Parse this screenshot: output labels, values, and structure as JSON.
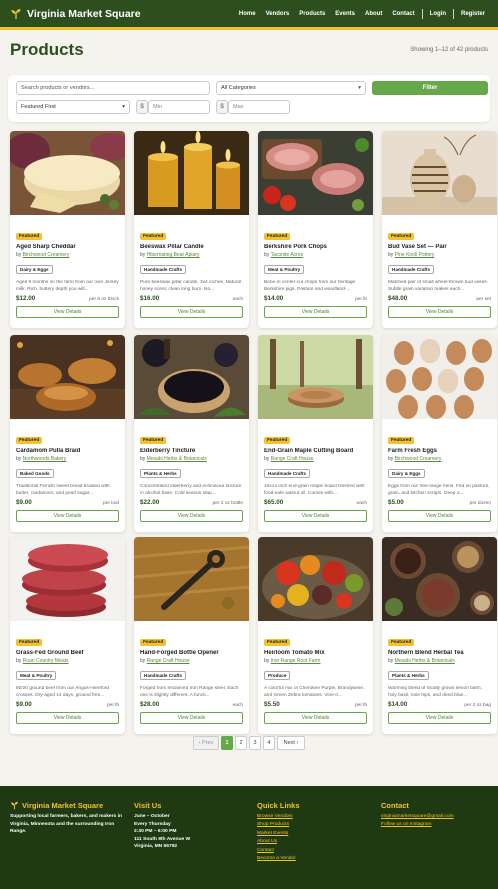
{
  "brand": "Virginia Market Square",
  "nav": {
    "links": [
      "Home",
      "Vendors",
      "Products",
      "Events",
      "About",
      "Contact"
    ],
    "account": [
      "Login",
      "Register"
    ]
  },
  "page": {
    "title": "Products",
    "showing": "Showing 1–12 of 42 products"
  },
  "filters": {
    "search_placeholder": "Search products or vendors...",
    "category_value": "All Categories",
    "sort_value": "Featured First",
    "currency_symbol": "$",
    "min_placeholder": "Min",
    "max_placeholder": "Max",
    "button_label": "Filter"
  },
  "products": [
    {
      "name": "Aged Sharp Cheddar",
      "featured": "Featured",
      "by": "by",
      "vendor": "Birchwood Creamery",
      "category": "Dairy & Eggs",
      "desc": "Aged 9 months on the farm from our own Jersey milk. Rich, buttery depth you will...",
      "price": "$12.00",
      "unit": "per 8 oz block",
      "button": "View Details",
      "image": "cheese"
    },
    {
      "name": "Beeswax Pillar Candle",
      "featured": "Featured",
      "by": "by",
      "vendor": "Hibernating Bear Apiary",
      "category": "Handmade Crafts",
      "desc": "Pure beeswax pillar candle, 3x4 inches. Natural honey scent, clean long burn. No...",
      "price": "$16.00",
      "unit": "each",
      "button": "View Details",
      "image": "candle"
    },
    {
      "name": "Berkshire Pork Chops",
      "featured": "Featured",
      "by": "by",
      "vendor": "Taconite Acres",
      "category": "Meat & Poultry",
      "desc": "Bone-in center-cut chops from our heritage Berkshire pigs. Pasture and woodland-...",
      "price": "$14.00",
      "unit": "per lb",
      "button": "View Details",
      "image": "pork"
    },
    {
      "name": "Bud Vase Set — Pair",
      "featured": "Featured",
      "by": "by",
      "vendor": "Pine Knoll Pottery",
      "category": "Handmade Crafts",
      "desc": "Matched pair of small wheel-thrown bud vases. Subtle grain variation makes each...",
      "price": "$48.00",
      "unit": "per set",
      "button": "View Details",
      "image": "vase"
    },
    {
      "name": "Cardamom Pulla Braid",
      "featured": "Featured",
      "by": "by",
      "vendor": "Northwoods Bakery",
      "category": "Baked Goods",
      "desc": "Traditional Finnish sweet bread braided with butter, cardamom, and pearl sugar...",
      "price": "$9.00",
      "unit": "per loaf",
      "button": "View Details",
      "image": "bread"
    },
    {
      "name": "Elderberry Tincture",
      "featured": "Featured",
      "by": "by",
      "vendor": "Mesabi Herbs & Botanicals",
      "category": "Plants & Herbs",
      "desc": "Concentrated elderberry and echinacea tincture in alcohol base. Cold season stap...",
      "price": "$22.00",
      "unit": "per 2 oz bottle",
      "button": "View Details",
      "image": "elderberry"
    },
    {
      "name": "End-Grain Maple Cutting Board",
      "featured": "Featured",
      "by": "by",
      "vendor": "Range Craft House",
      "category": "Handmade Crafts",
      "desc": "10x14 inch end-grain maple board finished with food-safe walnut oil. Comes with...",
      "price": "$65.00",
      "unit": "each",
      "button": "View Details",
      "image": "board"
    },
    {
      "name": "Farm Fresh Eggs",
      "featured": "Featured",
      "by": "by",
      "vendor": "Birchwood Creamery",
      "category": "Dairy & Eggs",
      "desc": "Eggs from our free-range hens. Fed on pasture, grain, and kitchen scraps. Deep o...",
      "price": "$5.00",
      "unit": "per dozen",
      "button": "View Details",
      "image": "eggs"
    },
    {
      "name": "Grass-Fed Ground Beef",
      "featured": "Featured",
      "by": "by",
      "vendor": "Roan Country Meats",
      "category": "Meat & Poultry",
      "desc": "80/20 ground beef from our Angus-Hereford crosses. Dry-aged 14 days, ground fres...",
      "price": "$9.00",
      "unit": "per lb",
      "button": "View Details",
      "image": "beef"
    },
    {
      "name": "Hand-Forged Bottle Opener",
      "featured": "Featured",
      "by": "by",
      "vendor": "Range Craft House",
      "category": "Handmade Crafts",
      "desc": "Forged from reclaimed Iron Range steel. Each one is slightly different. A functi...",
      "price": "$28.00",
      "unit": "each",
      "button": "View Details",
      "image": "opener"
    },
    {
      "name": "Heirloom Tomato Mix",
      "featured": "Featured",
      "by": "by",
      "vendor": "Iron Range Root Farm",
      "category": "Produce",
      "desc": "A colorful mix of Cherokee Purple, Brandywine, and Green Zebra tomatoes. Vine-ri...",
      "price": "$5.50",
      "unit": "per lb",
      "button": "View Details",
      "image": "tomato"
    },
    {
      "name": "Northern Blend Herbal Tea",
      "featured": "Featured",
      "by": "by",
      "vendor": "Mesabi Herbs & Botanicals",
      "category": "Plants & Herbs",
      "desc": "Warming blend of locally grown lemon balm, holy basil, rose hips, and dried blue...",
      "price": "$14.00",
      "unit": "per 2 oz bag",
      "button": "View Details",
      "image": "tea"
    }
  ],
  "pagination": {
    "prev": "‹ Prev",
    "pages": [
      "1",
      "2",
      "3",
      "4"
    ],
    "current": "1",
    "next": "Next ›"
  },
  "footer": {
    "brand": "Virginia Market Square",
    "tagline": "Supporting local farmers, bakers, and makers in Virginia, Minnesota and the surrounding Iron Range.",
    "visit_heading": "Visit Us",
    "visit_season": "June – October",
    "visit_day": "Every Thursday",
    "visit_time": "2:30 PM – 6:00 PM",
    "visit_address": "111 South 9th Avenue W",
    "visit_city": "Virginia, MN 55792",
    "links_heading": "Quick Links",
    "links": [
      "Browse Vendors",
      "Shop Products",
      "Market Events",
      "About Us",
      "Contact",
      "Become a Vendor"
    ],
    "contact_heading": "Contact",
    "email": "virginiamarketsquare@gmail.com",
    "instagram": "Follow us on Instagram"
  },
  "colors": {
    "header_bg": "#2d4f1e",
    "accent_yellow": "#f2c12e",
    "button_green": "#66a84a",
    "footer_bg": "#1f3a12"
  }
}
